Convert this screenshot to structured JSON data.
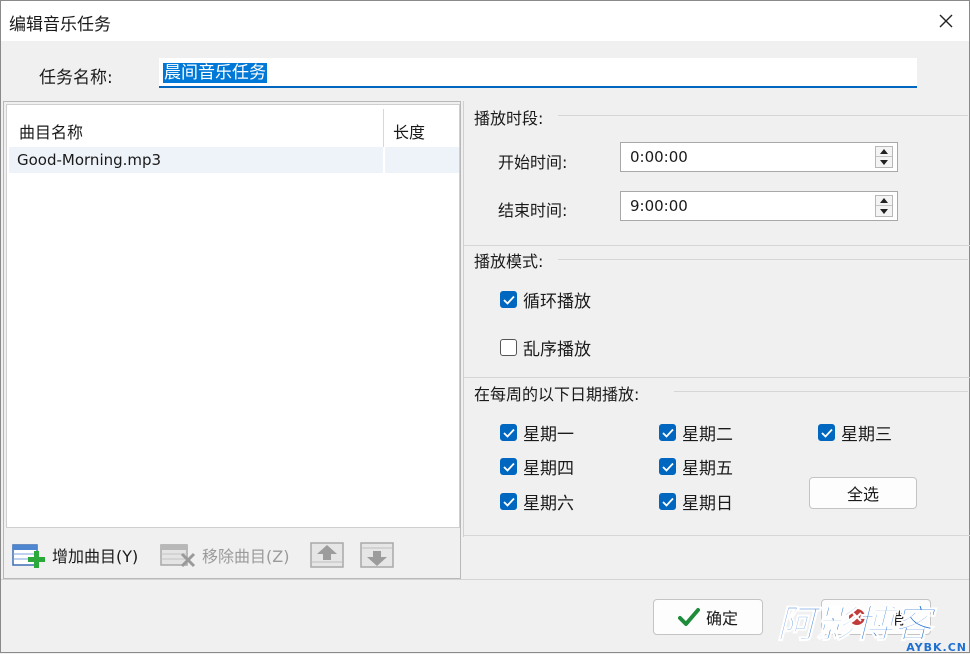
{
  "window": {
    "title": "编辑音乐任务"
  },
  "task_name": {
    "label": "任务名称:",
    "value": "晨间音乐任务"
  },
  "song_list": {
    "columns": [
      "曲目名称",
      "长度"
    ],
    "rows": [
      {
        "name": "Good-Morning.mp3",
        "length": ""
      }
    ]
  },
  "toolbar": {
    "add_label": "增加曲目(Y)",
    "remove_label": "移除曲目(Z)"
  },
  "play_period": {
    "title": "播放时段:",
    "start_label": "开始时间:",
    "start_value": "0:00:00",
    "end_label": "结束时间:",
    "end_value": "9:00:00"
  },
  "play_mode": {
    "title": "播放模式:",
    "loop": {
      "label": "循环播放",
      "checked": true
    },
    "shuffle": {
      "label": "乱序播放",
      "checked": false
    }
  },
  "weekdays": {
    "title": "在每周的以下日期播放:",
    "days": [
      {
        "label": "星期一",
        "checked": true
      },
      {
        "label": "星期二",
        "checked": true
      },
      {
        "label": "星期三",
        "checked": true
      },
      {
        "label": "星期四",
        "checked": true
      },
      {
        "label": "星期五",
        "checked": true
      },
      {
        "label": "星期六",
        "checked": true
      },
      {
        "label": "星期日",
        "checked": true
      }
    ],
    "select_all_label": "全选"
  },
  "footer": {
    "ok_label": "确定",
    "cancel_label": "取消"
  },
  "watermark": {
    "text": "阿影博客",
    "domain": "AYBK.CN"
  },
  "colors": {
    "accent": "#0067c0",
    "ok_icon": "#1e8c3a",
    "watermark": "#1f6fd1"
  },
  "icons": {
    "close": "close-icon",
    "add": "add-song-icon",
    "remove": "remove-song-icon",
    "move_up": "move-up-icon",
    "move_down": "move-down-icon",
    "ok": "checkmark-icon",
    "cancel": "cancel-icon",
    "checkbox": "checkmark-icon"
  }
}
